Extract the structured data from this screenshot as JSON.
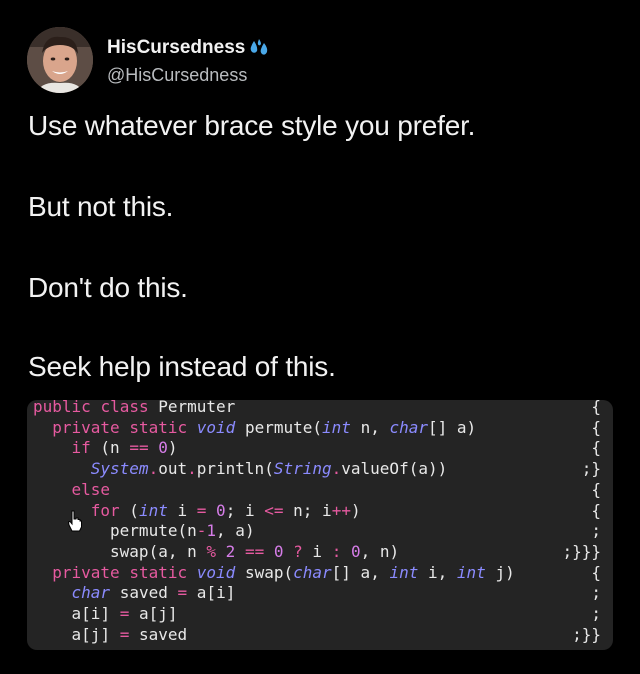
{
  "user": {
    "display_name": "HisCursedness",
    "handle": "@HisCursedness",
    "emoji": "sweat-droplets-icon"
  },
  "tweet": {
    "lines": [
      "Use whatever brace style you prefer.",
      "But not this.",
      "Don't do this.",
      "Seek help instead of this."
    ]
  },
  "code": {
    "lines": [
      {
        "indent": 0,
        "text": "public class Permuter",
        "brace": "{"
      },
      {
        "indent": 4,
        "text": "private static void permute(int n, char[] a)",
        "brace": "{"
      },
      {
        "indent": 8,
        "text": "if (n == 0)",
        "brace": "{"
      },
      {
        "indent": 12,
        "text": "System.out.println(String.valueOf(a))",
        "brace": ";}"
      },
      {
        "indent": 8,
        "text": "else",
        "brace": "{"
      },
      {
        "indent": 12,
        "text": "for (int i = 0; i <= n; i++)",
        "brace": "{"
      },
      {
        "indent": 16,
        "text": "permute(n-1, a)",
        "brace": ";"
      },
      {
        "indent": 16,
        "text": "swap(a, n % 2 == 0 ? i : 0, n)",
        "brace": ";}}}"
      },
      {
        "indent": 4,
        "text": "private static void swap(char[] a, int i, int j)",
        "brace": "{"
      },
      {
        "indent": 8,
        "text": "char saved = a[i]",
        "brace": ";"
      },
      {
        "indent": 8,
        "text": "a[i] = a[j]",
        "brace": ";"
      },
      {
        "indent": 8,
        "text": "a[j] = saved",
        "brace": ";}}"
      }
    ]
  },
  "colors": {
    "background": "#000000",
    "code_background": "#242424",
    "keyword": "#e65aa0",
    "type": "#8b8bff",
    "number": "#d67de8"
  }
}
